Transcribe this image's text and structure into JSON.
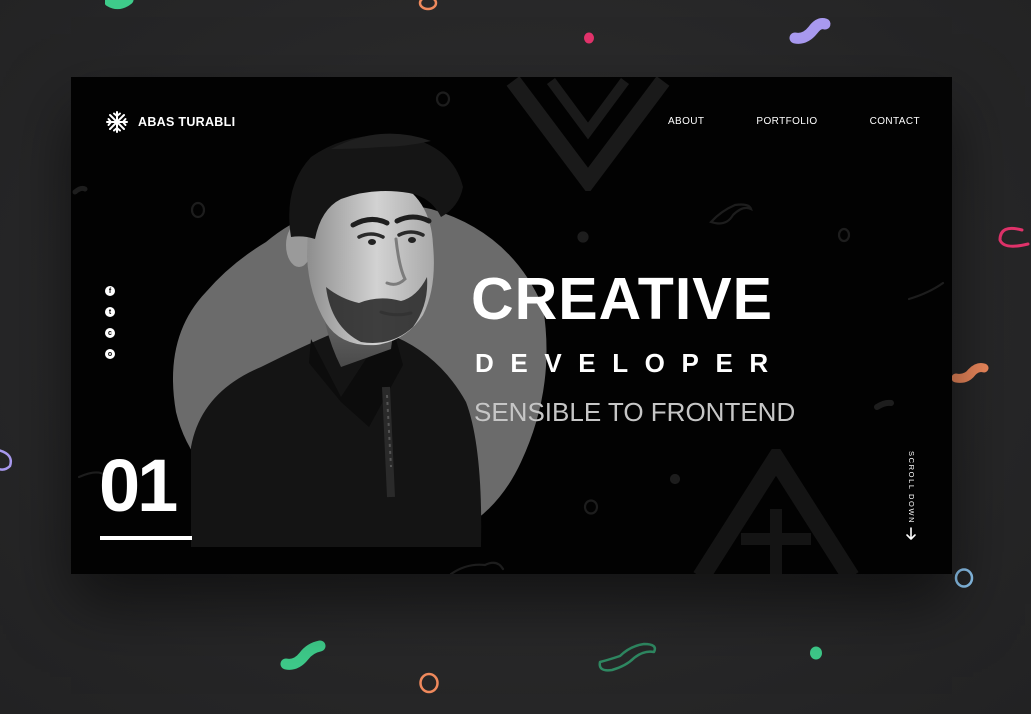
{
  "brand": {
    "name": "ABAS TURABLI",
    "logo_icon": "snowflake-icon"
  },
  "nav": {
    "items": [
      {
        "label": "ABOUT"
      },
      {
        "label": "PORTFOLIO"
      },
      {
        "label": "CONTACT"
      }
    ]
  },
  "social": {
    "items": [
      {
        "icon": "facebook-icon",
        "glyph": "f"
      },
      {
        "icon": "twitter-icon",
        "glyph": "t"
      },
      {
        "icon": "github-icon",
        "glyph": "c"
      },
      {
        "icon": "dribbble-icon",
        "glyph": "o"
      }
    ]
  },
  "hero": {
    "headline": "CREATIVE",
    "subheadline": "DEVELOPER",
    "tagline": "SENSIBLE TO FRONTEND"
  },
  "slide": {
    "number": "01"
  },
  "scroll": {
    "label": "SCROLL DOWN"
  },
  "colors": {
    "page_background": "#2a2a2b",
    "card_background": "#020202",
    "blob": "#6b6b6b",
    "text": "#ffffff",
    "tagline": "#c6c6c6",
    "deco_green": "#3ecb8a",
    "deco_purple": "#a99af0",
    "deco_pink": "#e2336b",
    "deco_orange": "#f08a5d",
    "deco_blue": "#8ec7f2"
  }
}
